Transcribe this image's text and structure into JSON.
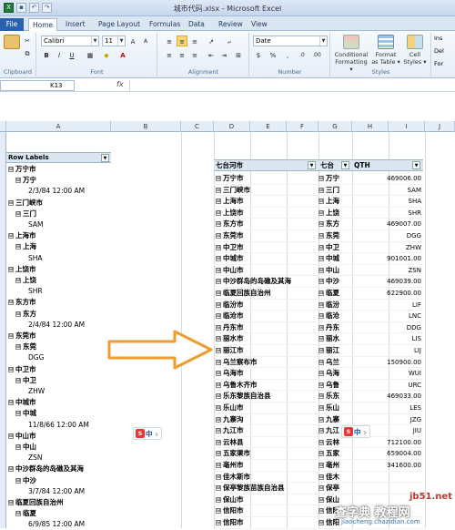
{
  "window": {
    "title": "城市代码.xlsx - Microsoft Excel"
  },
  "ribbon_tabs": [
    "File",
    "Home",
    "Insert",
    "Page Layout",
    "Formulas",
    "Data",
    "Review",
    "View"
  ],
  "ribbon": {
    "font_name": "Calibri",
    "font_size": "11",
    "number_format": "Date",
    "groups": {
      "clipboard": "Clipboard",
      "font": "Font",
      "alignment": "Alignment",
      "number": "Number",
      "styles": "Styles"
    },
    "styles_buttons": [
      {
        "label1": "Conditional",
        "label2": "Formatting ▾"
      },
      {
        "label1": "Format",
        "label2": "as Table ▾"
      },
      {
        "label1": "Cell",
        "label2": "Styles ▾"
      }
    ],
    "cells_buttons": [
      "Ins",
      "Del",
      "For"
    ],
    "accent": "#2b62b0",
    "highlight": "#fbd873"
  },
  "formula_bar": {
    "name_box": "K13",
    "fx": "fx",
    "formula": ""
  },
  "columns": [
    "A",
    "B",
    "C",
    "D",
    "E",
    "F",
    "G",
    "H",
    "I",
    "J"
  ],
  "left_pivot": {
    "header": "Row Labels",
    "rows": [
      {
        "level": 0,
        "text": "万宁市",
        "expand": "⊟"
      },
      {
        "level": 1,
        "text": "万宁",
        "expand": "⊟"
      },
      {
        "level": 2,
        "text": "2/3/84 12:00 AM"
      },
      {
        "level": 0,
        "text": "三门峡市",
        "expand": "⊟"
      },
      {
        "level": 1,
        "text": "三门",
        "expand": "⊟"
      },
      {
        "level": 2,
        "text": "SAM"
      },
      {
        "level": 0,
        "text": "上海市",
        "expand": "⊟"
      },
      {
        "level": 1,
        "text": "上海",
        "expand": "⊟"
      },
      {
        "level": 2,
        "text": "SHA"
      },
      {
        "level": 0,
        "text": "上饶市",
        "expand": "⊟"
      },
      {
        "level": 1,
        "text": "上饶",
        "expand": "⊟"
      },
      {
        "level": 2,
        "text": "SHR"
      },
      {
        "level": 0,
        "text": "东方市",
        "expand": "⊟"
      },
      {
        "level": 1,
        "text": "东方",
        "expand": "⊟"
      },
      {
        "level": 2,
        "text": "2/4/84 12:00 AM"
      },
      {
        "level": 0,
        "text": "东莞市",
        "expand": "⊟"
      },
      {
        "level": 1,
        "text": "东莞",
        "expand": "⊟"
      },
      {
        "level": 2,
        "text": "DGG"
      },
      {
        "level": 0,
        "text": "中卫市",
        "expand": "⊟"
      },
      {
        "level": 1,
        "text": "中卫",
        "expand": "⊟"
      },
      {
        "level": 2,
        "text": "ZHW"
      },
      {
        "level": 0,
        "text": "中城市",
        "expand": "⊟"
      },
      {
        "level": 1,
        "text": "中城",
        "expand": "⊟"
      },
      {
        "level": 2,
        "text": "11/8/66 12:00 AM"
      },
      {
        "level": 0,
        "text": "中山市",
        "expand": "⊟"
      },
      {
        "level": 1,
        "text": "中山",
        "expand": "⊟"
      },
      {
        "level": 2,
        "text": "ZSN"
      },
      {
        "level": 0,
        "text": "中沙群岛的岛礁及其海",
        "expand": "⊟"
      },
      {
        "level": 1,
        "text": "中沙",
        "expand": "⊟"
      },
      {
        "level": 2,
        "text": "3/7/84 12:00 AM"
      },
      {
        "level": 0,
        "text": "临夏回族自治州",
        "expand": "⊟"
      },
      {
        "level": 1,
        "text": "临夏",
        "expand": "⊟"
      },
      {
        "level": 2,
        "text": "6/9/85 12:00 AM"
      }
    ]
  },
  "right_pivot": {
    "headers": [
      "七台河市",
      "七台",
      "QTH"
    ],
    "rows": [
      [
        "万宁市",
        "万宁",
        "469006.00"
      ],
      [
        "三门峡市",
        "三门",
        "SAM"
      ],
      [
        "上海市",
        "上海",
        "SHA"
      ],
      [
        "上饶市",
        "上饶",
        "SHR"
      ],
      [
        "东方市",
        "东方",
        "469007.00"
      ],
      [
        "东莞市",
        "东莞",
        "DGG"
      ],
      [
        "中卫市",
        "中卫",
        "ZHW"
      ],
      [
        "中城市",
        "中城",
        "901001.00"
      ],
      [
        "中山市",
        "中山",
        "ZSN"
      ],
      [
        "中沙群岛的岛礁及其海",
        "中沙",
        "469039.00"
      ],
      [
        "临夏回族自治州",
        "临夏",
        "622900.00"
      ],
      [
        "临汾市",
        "临汾",
        "LIF"
      ],
      [
        "临沧市",
        "临沧",
        "LNC"
      ],
      [
        "丹东市",
        "丹东",
        "DDG"
      ],
      [
        "丽水市",
        "丽水",
        "LIS"
      ],
      [
        "丽江市",
        "丽江",
        "LIJ"
      ],
      [
        "乌兰察布市",
        "乌兰",
        "150900.00"
      ],
      [
        "乌海市",
        "乌海",
        "WUI"
      ],
      [
        "乌鲁木齐市",
        "乌鲁",
        "URC"
      ],
      [
        "乐东黎族自治县",
        "乐东",
        "469033.00"
      ],
      [
        "乐山市",
        "乐山",
        "LES"
      ],
      [
        "九寨沟",
        "九寨",
        "JZG"
      ],
      [
        "九江市",
        "九江",
        "JIU"
      ],
      [
        "云林县",
        "云林",
        "712100.00"
      ],
      [
        "五家渠市",
        "五家",
        "659004.00"
      ],
      [
        "亳州市",
        "亳州",
        "341600.00"
      ],
      [
        "佳木斯市",
        "佳木",
        ""
      ],
      [
        "保亭黎族苗族自治县",
        "保亭",
        ""
      ],
      [
        "保山市",
        "保山",
        ""
      ],
      [
        "信阳市",
        "信阳",
        ""
      ],
      [
        "信阳市",
        "信阳",
        ""
      ]
    ]
  },
  "ime_toolbar": {
    "logo": "S",
    "lang": "中",
    "punct": "ゝ"
  },
  "watermark": {
    "site": "jb51.net",
    "brand": "查字典 教程网",
    "url": "jiaocheng.chazidian.com"
  }
}
